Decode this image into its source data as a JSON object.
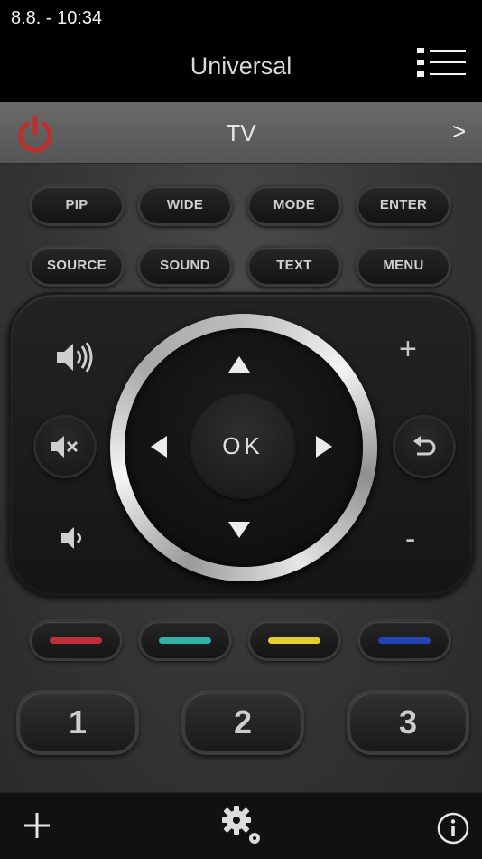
{
  "status": {
    "time": "8.8. - 10:34"
  },
  "header": {
    "title": "Universal"
  },
  "device_bar": {
    "device": "TV",
    "next": ">"
  },
  "function_buttons": {
    "row1": [
      "PIP",
      "WIDE",
      "MODE",
      "ENTER"
    ],
    "row2": [
      "SOURCE",
      "SOUND",
      "TEXT",
      "MENU"
    ]
  },
  "dpad": {
    "ok": "OK",
    "plus": "+",
    "minus": "-"
  },
  "color_buttons": [
    {
      "name": "red",
      "color": "#c0303c"
    },
    {
      "name": "green",
      "color": "#2fb3a8"
    },
    {
      "name": "yellow",
      "color": "#e3d02c"
    },
    {
      "name": "blue",
      "color": "#2643b5"
    }
  ],
  "number_buttons": [
    "1",
    "2",
    "3"
  ],
  "icons": {
    "menu": "list-menu-icon",
    "power": "power-icon",
    "volume_up": "volume-up-icon",
    "volume_down": "volume-down-icon",
    "mute": "mute-icon",
    "back": "back-icon",
    "add": "add-icon",
    "settings": "gear-icon",
    "info": "info-icon"
  },
  "colors": {
    "power": "#c0302b",
    "background": "#353535"
  }
}
